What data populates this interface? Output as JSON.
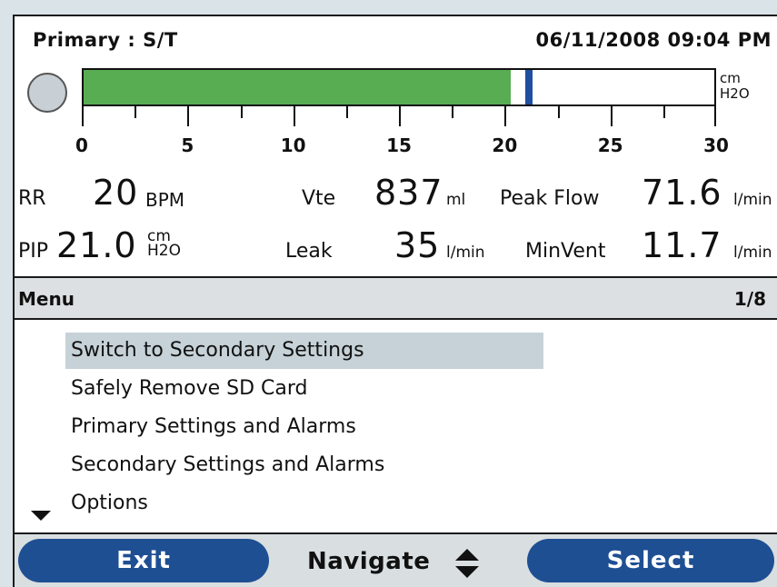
{
  "header": {
    "mode": "Primary : S/T",
    "datetime": "06/11/2008 09:04 PM"
  },
  "pressure_bar": {
    "unit_line1": "cm",
    "unit_line2": "H2O",
    "scale_min": 0,
    "scale_max": 30,
    "fill_value": 20.3,
    "marker_value": 21.2,
    "fill_color": "#58ad52",
    "marker_color": "#1e4fa0",
    "scale_labels": [
      "0",
      "5",
      "10",
      "15",
      "20",
      "25",
      "30"
    ]
  },
  "metrics": {
    "rr": {
      "label": "RR",
      "value": "20",
      "unit": "BPM"
    },
    "vte": {
      "label": "Vte",
      "value": "837",
      "unit": "ml"
    },
    "peak_flow": {
      "label": "Peak Flow",
      "value": "71.6",
      "unit": "l/min"
    },
    "pip": {
      "label": "PIP",
      "value": "21.0",
      "unit_line1": "cm",
      "unit_line2": "H2O"
    },
    "leak": {
      "label": "Leak",
      "value": "35",
      "unit": "l/min"
    },
    "min_vent": {
      "label": "MinVent",
      "value": "11.7",
      "unit": "l/min"
    }
  },
  "menu": {
    "title": "Menu",
    "page": "1/8",
    "items": [
      {
        "label": "Switch to Secondary Settings",
        "selected": true
      },
      {
        "label": "Safely Remove SD Card",
        "selected": false
      },
      {
        "label": "Primary Settings and Alarms",
        "selected": false
      },
      {
        "label": "Secondary Settings and Alarms",
        "selected": false
      },
      {
        "label": "Options",
        "selected": false
      }
    ]
  },
  "softkeys": {
    "exit_label": "Exit",
    "navigate_label": "Navigate",
    "select_label": "Select",
    "button_color": "#1f4f93"
  }
}
